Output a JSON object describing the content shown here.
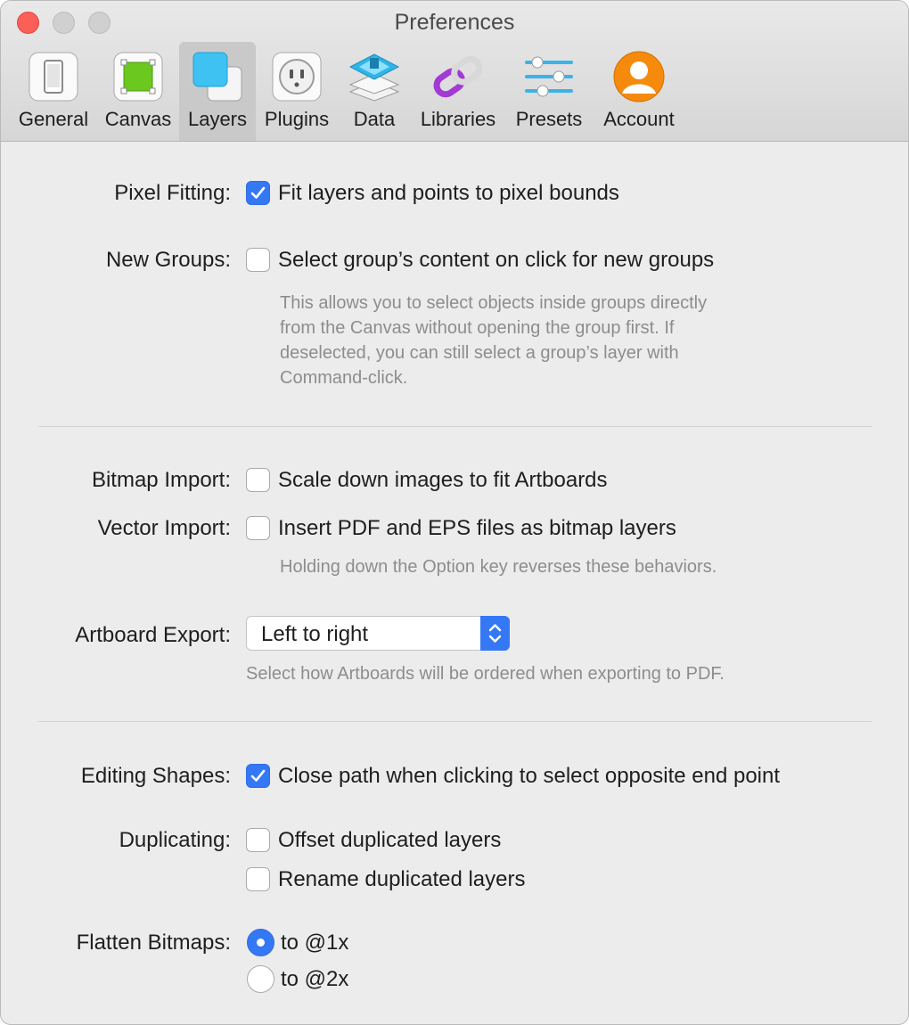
{
  "window": {
    "title": "Preferences"
  },
  "tabs": [
    {
      "label": "General",
      "icon": "phone-icon"
    },
    {
      "label": "Canvas",
      "icon": "canvas-icon"
    },
    {
      "label": "Layers",
      "icon": "layers-icon",
      "selected": true
    },
    {
      "label": "Plugins",
      "icon": "plug-icon"
    },
    {
      "label": "Data",
      "icon": "data-stack-icon"
    },
    {
      "label": "Libraries",
      "icon": "link-icon"
    },
    {
      "label": "Presets",
      "icon": "sliders-icon"
    },
    {
      "label": "Account",
      "icon": "user-icon"
    }
  ],
  "settings": {
    "pixel_fitting": {
      "label": "Pixel Fitting:",
      "option": "Fit layers and points to pixel bounds",
      "checked": true
    },
    "new_groups": {
      "label": "New Groups:",
      "option": "Select group’s content on click for new groups",
      "checked": false,
      "help": [
        "This allows you to select objects inside groups directly",
        "from the Canvas without opening the group first. If",
        "deselected, you can still select a group’s layer with",
        "Command-click."
      ]
    },
    "bitmap_import": {
      "label": "Bitmap Import:",
      "option": "Scale down images to fit Artboards",
      "checked": false
    },
    "vector_import": {
      "label": "Vector Import:",
      "option": "Insert PDF and EPS files as bitmap layers",
      "checked": false,
      "help": "Holding down the Option key reverses these behaviors."
    },
    "artboard_export": {
      "label": "Artboard Export:",
      "value": "Left to right",
      "help": "Select how Artboards will be ordered when exporting to PDF."
    },
    "editing_shapes": {
      "label": "Editing Shapes:",
      "option": "Close path when clicking to select opposite end point",
      "checked": true
    },
    "duplicating": {
      "label": "Duplicating:",
      "options": [
        {
          "option": "Offset duplicated layers",
          "checked": false
        },
        {
          "option": "Rename duplicated layers",
          "checked": false
        }
      ]
    },
    "flatten_bitmaps": {
      "label": "Flatten Bitmaps:",
      "options": [
        {
          "option": "to @1x",
          "selected": true
        },
        {
          "option": "to @2x",
          "selected": false
        }
      ]
    }
  },
  "colors": {
    "accent": "#3478f6",
    "close": "#fc5f57"
  }
}
